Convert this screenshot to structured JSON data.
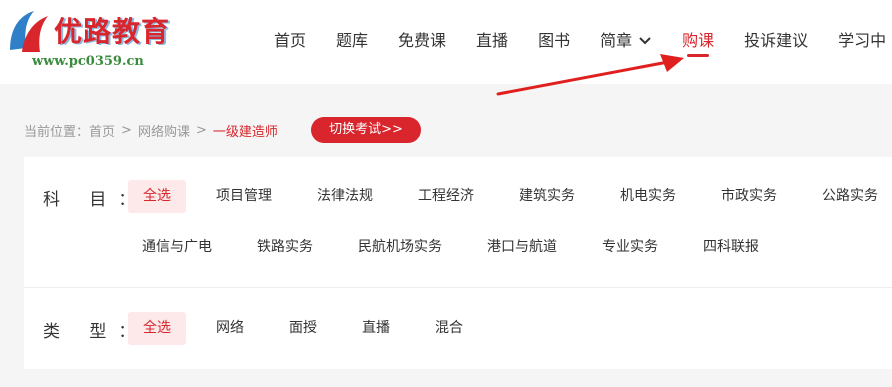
{
  "logo": {
    "text": "优路教育",
    "watermark": "www.pc0359.cn"
  },
  "nav": [
    {
      "label": "首页"
    },
    {
      "label": "题库"
    },
    {
      "label": "免费课"
    },
    {
      "label": "直播"
    },
    {
      "label": "图书"
    },
    {
      "label": "简章"
    },
    {
      "label": "购课",
      "active": true
    },
    {
      "label": "投诉建议"
    },
    {
      "label": "学习中"
    }
  ],
  "breadcrumb": {
    "prefix": "当前位置：",
    "home": "首页",
    "separator": ">",
    "category": "网络购课",
    "current": "一级建造师"
  },
  "switch_exam_button": "切换考试>>",
  "filters": {
    "subject": {
      "label": "科 目：",
      "options": [
        "全选",
        "项目管理",
        "法律法规",
        "工程经济",
        "建筑实务",
        "机电实务",
        "市政实务",
        "公路实务",
        "通信与广电",
        "铁路实务",
        "民航机场实务",
        "港口与航道",
        "专业实务",
        "四科联报"
      ],
      "selected": "全选"
    },
    "type": {
      "label": "类 型：",
      "options": [
        "全选",
        "网络",
        "面授",
        "直播",
        "混合"
      ],
      "selected": "全选"
    }
  },
  "colors": {
    "accent": "#d8262c",
    "selected_bg": "#fde9e9",
    "annotation_arrow": "#e0201f"
  },
  "icons": {
    "dropdown": "chevron-down-icon",
    "logo": "youlu-logo-icon"
  }
}
